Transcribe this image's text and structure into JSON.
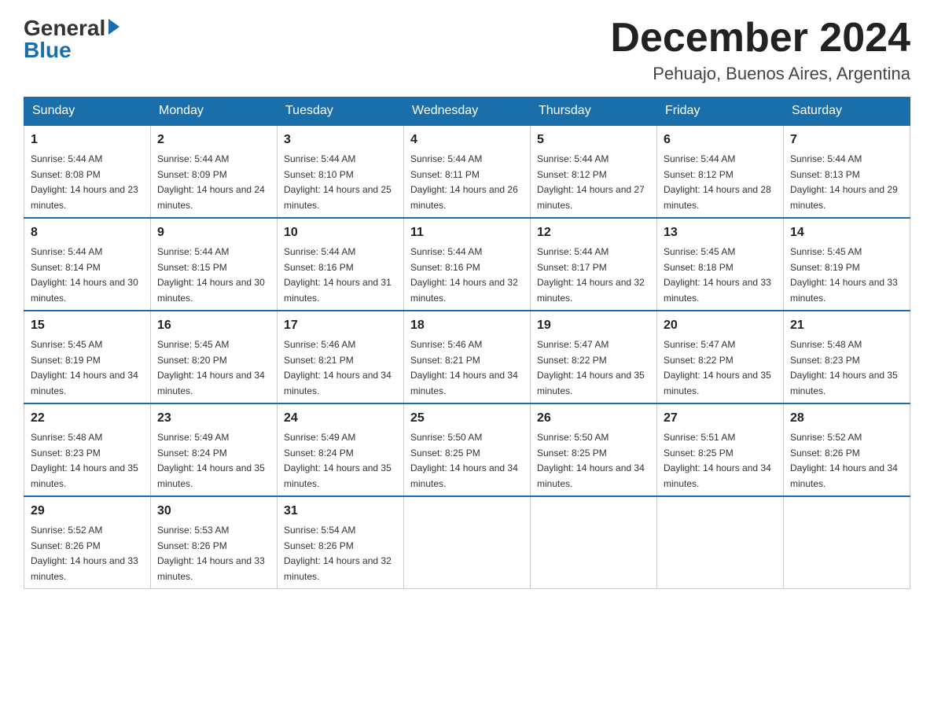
{
  "header": {
    "logo": {
      "general": "General",
      "blue": "Blue"
    },
    "title": "December 2024",
    "subtitle": "Pehuajo, Buenos Aires, Argentina"
  },
  "days_of_week": [
    "Sunday",
    "Monday",
    "Tuesday",
    "Wednesday",
    "Thursday",
    "Friday",
    "Saturday"
  ],
  "weeks": [
    [
      {
        "num": "1",
        "sunrise": "5:44 AM",
        "sunset": "8:08 PM",
        "daylight": "14 hours and 23 minutes."
      },
      {
        "num": "2",
        "sunrise": "5:44 AM",
        "sunset": "8:09 PM",
        "daylight": "14 hours and 24 minutes."
      },
      {
        "num": "3",
        "sunrise": "5:44 AM",
        "sunset": "8:10 PM",
        "daylight": "14 hours and 25 minutes."
      },
      {
        "num": "4",
        "sunrise": "5:44 AM",
        "sunset": "8:11 PM",
        "daylight": "14 hours and 26 minutes."
      },
      {
        "num": "5",
        "sunrise": "5:44 AM",
        "sunset": "8:12 PM",
        "daylight": "14 hours and 27 minutes."
      },
      {
        "num": "6",
        "sunrise": "5:44 AM",
        "sunset": "8:12 PM",
        "daylight": "14 hours and 28 minutes."
      },
      {
        "num": "7",
        "sunrise": "5:44 AM",
        "sunset": "8:13 PM",
        "daylight": "14 hours and 29 minutes."
      }
    ],
    [
      {
        "num": "8",
        "sunrise": "5:44 AM",
        "sunset": "8:14 PM",
        "daylight": "14 hours and 30 minutes."
      },
      {
        "num": "9",
        "sunrise": "5:44 AM",
        "sunset": "8:15 PM",
        "daylight": "14 hours and 30 minutes."
      },
      {
        "num": "10",
        "sunrise": "5:44 AM",
        "sunset": "8:16 PM",
        "daylight": "14 hours and 31 minutes."
      },
      {
        "num": "11",
        "sunrise": "5:44 AM",
        "sunset": "8:16 PM",
        "daylight": "14 hours and 32 minutes."
      },
      {
        "num": "12",
        "sunrise": "5:44 AM",
        "sunset": "8:17 PM",
        "daylight": "14 hours and 32 minutes."
      },
      {
        "num": "13",
        "sunrise": "5:45 AM",
        "sunset": "8:18 PM",
        "daylight": "14 hours and 33 minutes."
      },
      {
        "num": "14",
        "sunrise": "5:45 AM",
        "sunset": "8:19 PM",
        "daylight": "14 hours and 33 minutes."
      }
    ],
    [
      {
        "num": "15",
        "sunrise": "5:45 AM",
        "sunset": "8:19 PM",
        "daylight": "14 hours and 34 minutes."
      },
      {
        "num": "16",
        "sunrise": "5:45 AM",
        "sunset": "8:20 PM",
        "daylight": "14 hours and 34 minutes."
      },
      {
        "num": "17",
        "sunrise": "5:46 AM",
        "sunset": "8:21 PM",
        "daylight": "14 hours and 34 minutes."
      },
      {
        "num": "18",
        "sunrise": "5:46 AM",
        "sunset": "8:21 PM",
        "daylight": "14 hours and 34 minutes."
      },
      {
        "num": "19",
        "sunrise": "5:47 AM",
        "sunset": "8:22 PM",
        "daylight": "14 hours and 35 minutes."
      },
      {
        "num": "20",
        "sunrise": "5:47 AM",
        "sunset": "8:22 PM",
        "daylight": "14 hours and 35 minutes."
      },
      {
        "num": "21",
        "sunrise": "5:48 AM",
        "sunset": "8:23 PM",
        "daylight": "14 hours and 35 minutes."
      }
    ],
    [
      {
        "num": "22",
        "sunrise": "5:48 AM",
        "sunset": "8:23 PM",
        "daylight": "14 hours and 35 minutes."
      },
      {
        "num": "23",
        "sunrise": "5:49 AM",
        "sunset": "8:24 PM",
        "daylight": "14 hours and 35 minutes."
      },
      {
        "num": "24",
        "sunrise": "5:49 AM",
        "sunset": "8:24 PM",
        "daylight": "14 hours and 35 minutes."
      },
      {
        "num": "25",
        "sunrise": "5:50 AM",
        "sunset": "8:25 PM",
        "daylight": "14 hours and 34 minutes."
      },
      {
        "num": "26",
        "sunrise": "5:50 AM",
        "sunset": "8:25 PM",
        "daylight": "14 hours and 34 minutes."
      },
      {
        "num": "27",
        "sunrise": "5:51 AM",
        "sunset": "8:25 PM",
        "daylight": "14 hours and 34 minutes."
      },
      {
        "num": "28",
        "sunrise": "5:52 AM",
        "sunset": "8:26 PM",
        "daylight": "14 hours and 34 minutes."
      }
    ],
    [
      {
        "num": "29",
        "sunrise": "5:52 AM",
        "sunset": "8:26 PM",
        "daylight": "14 hours and 33 minutes."
      },
      {
        "num": "30",
        "sunrise": "5:53 AM",
        "sunset": "8:26 PM",
        "daylight": "14 hours and 33 minutes."
      },
      {
        "num": "31",
        "sunrise": "5:54 AM",
        "sunset": "8:26 PM",
        "daylight": "14 hours and 32 minutes."
      },
      null,
      null,
      null,
      null
    ]
  ]
}
